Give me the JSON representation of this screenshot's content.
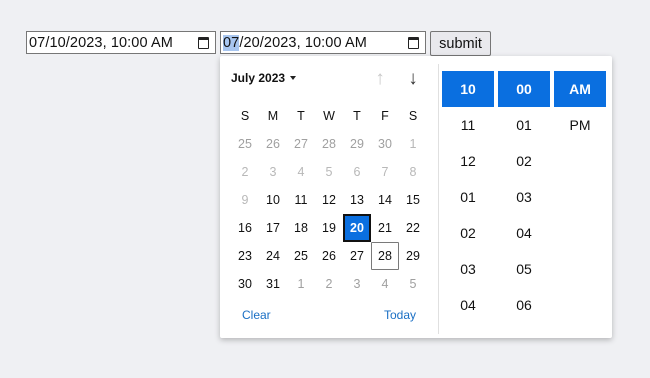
{
  "form": {
    "start_input_value": "07/10/2023, 10:00 AM",
    "end_input_month": "07",
    "end_input_rest": "/20/2023, 10:00 AM",
    "submit_label": "submit"
  },
  "picker": {
    "month_label": "July 2023",
    "weekdays": [
      "S",
      "M",
      "T",
      "W",
      "T",
      "F",
      "S"
    ],
    "weeks": [
      [
        "25",
        "26",
        "27",
        "28",
        "29",
        "30",
        "1"
      ],
      [
        "2",
        "3",
        "4",
        "5",
        "6",
        "7",
        "8"
      ],
      [
        "9",
        "10",
        "11",
        "12",
        "13",
        "14",
        "15"
      ],
      [
        "16",
        "17",
        "18",
        "19",
        "20",
        "21",
        "22"
      ],
      [
        "23",
        "24",
        "25",
        "26",
        "27",
        "28",
        "29"
      ],
      [
        "30",
        "31",
        "1",
        "2",
        "3",
        "4",
        "5"
      ]
    ],
    "selected_day": "20",
    "today_day": "28",
    "clear_label": "Clear",
    "today_label": "Today",
    "hours": [
      "10",
      "11",
      "12",
      "01",
      "02",
      "03",
      "04"
    ],
    "minutes": [
      "00",
      "01",
      "02",
      "03",
      "04",
      "05",
      "06"
    ],
    "ampm": [
      "AM",
      "PM"
    ],
    "selected_hour": "10",
    "selected_minute": "00",
    "selected_ampm": "AM"
  },
  "colors": {
    "page_background": "#eff0f3",
    "accent": "#0a6fe0",
    "link": "#1a6fc4"
  },
  "icons": {
    "start_picker_icon": "calendar-icon",
    "end_picker_icon": "calendar-icon",
    "prev_month_icon": "arrow-up-icon",
    "next_month_icon": "arrow-down-icon",
    "month_dropdown_icon": "caret-down-icon"
  }
}
